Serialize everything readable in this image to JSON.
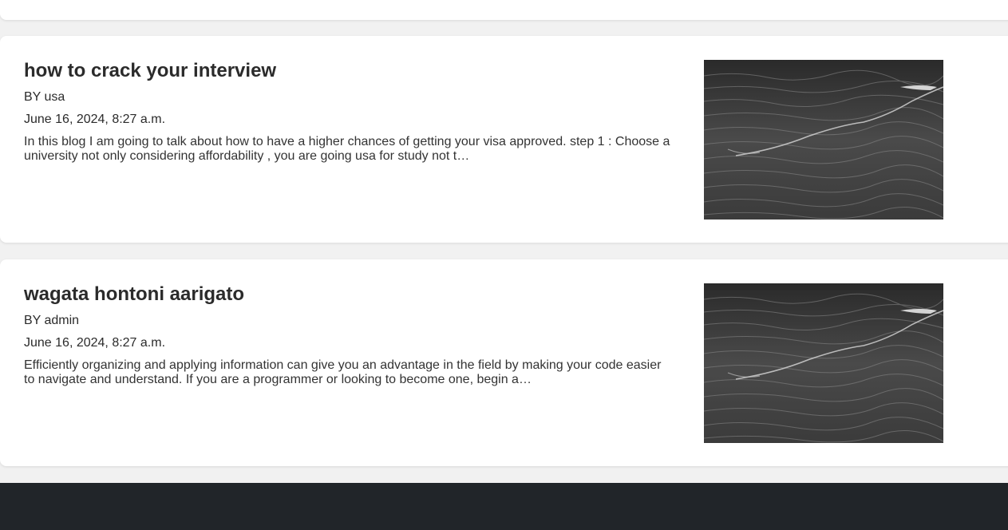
{
  "posts": [
    {
      "title": "how to crack your interview",
      "author": "BY usa",
      "date": "June 16, 2024, 8:27 a.m.",
      "excerpt": "In this blog I am going to talk about how to have a higher chances of getting your visa approved. step 1 : Choose a university not only considering affordability , you are going usa for study not t…"
    },
    {
      "title": "wagata hontoni aarigato",
      "author": "BY admin",
      "date": "June 16, 2024, 8:27 a.m.",
      "excerpt": "Efficiently organizing and applying information can give you an advantage in the field by making your code easier to navigate and understand. If you are a programmer or looking to become one, begin a…"
    }
  ],
  "colors": {
    "page_background": "#f1f1f1",
    "card_background": "#ffffff",
    "text": "#2b2b2b",
    "footer": "#212529"
  },
  "icons": {
    "post_image": "dark-water-waves-image"
  }
}
